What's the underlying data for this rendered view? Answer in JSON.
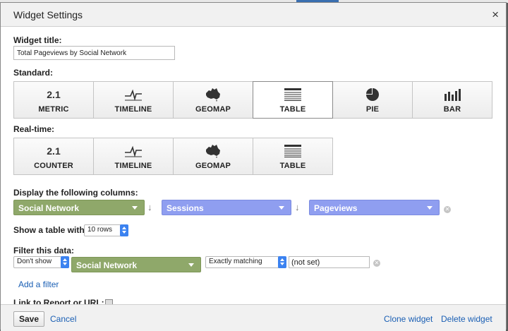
{
  "dialog": {
    "title": "Widget Settings",
    "close_glyph": "×"
  },
  "widget_title": {
    "label": "Widget title:",
    "value": "Total Pageviews by Social Network"
  },
  "standard": {
    "label": "Standard:",
    "tiles": [
      {
        "icon": "metric-icon",
        "icon_text": "2.1",
        "label": "METRIC",
        "selected": false
      },
      {
        "icon": "timeline-icon",
        "label": "TIMELINE",
        "selected": false
      },
      {
        "icon": "geomap-icon",
        "label": "GEOMAP",
        "selected": false
      },
      {
        "icon": "table-icon",
        "label": "TABLE",
        "selected": true
      },
      {
        "icon": "pie-icon",
        "label": "PIE",
        "selected": false
      },
      {
        "icon": "bar-icon",
        "label": "BAR",
        "selected": false
      }
    ]
  },
  "realtime": {
    "label": "Real-time:",
    "tiles": [
      {
        "icon": "counter-icon",
        "icon_text": "2.1",
        "label": "COUNTER"
      },
      {
        "icon": "timeline-icon",
        "label": "TIMELINE"
      },
      {
        "icon": "geomap-icon",
        "label": "GEOMAP"
      },
      {
        "icon": "table-icon",
        "label": "TABLE"
      }
    ]
  },
  "columns": {
    "label": "Display the following columns:",
    "items": [
      {
        "value": "Social Network",
        "color": "#8fa86a"
      },
      {
        "value": "Sessions",
        "color": "#8f9ef0"
      },
      {
        "value": "Pageviews",
        "color": "#8f9ef0"
      }
    ],
    "sort_glyph": "↓"
  },
  "rows": {
    "label": "Show a table with",
    "value": "10 rows"
  },
  "filter": {
    "label": "Filter this data:",
    "mode": "Don't show",
    "dimension": "Social Network",
    "match": "Exactly matching",
    "value": "(not set)",
    "add_label": "Add a filter"
  },
  "link_to_report": {
    "label": "Link to Report or URL:"
  },
  "footer": {
    "save": "Save",
    "cancel": "Cancel",
    "clone": "Clone widget",
    "delete": "Delete widget"
  },
  "colors": {
    "accent_blue": "#1a5fb4",
    "spinner_blue": "#3b82f0"
  }
}
